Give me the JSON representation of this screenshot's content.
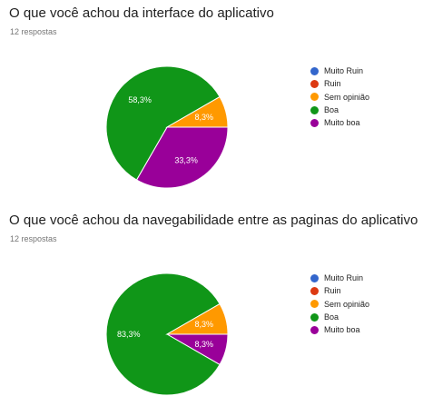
{
  "chart_data": [
    {
      "type": "pie",
      "title": "O que você achou da interface do aplicativo",
      "subtitle": "12 respostas",
      "legend_position": "right",
      "categories": [
        "Muito Ruin",
        "Ruin",
        "Sem opinião",
        "Boa",
        "Muito boa"
      ],
      "colors": [
        "#3366cc",
        "#dc3912",
        "#ff9900",
        "#109618",
        "#990099"
      ],
      "values": [
        0,
        0,
        8.3,
        58.3,
        33.3
      ],
      "labels": [
        "",
        "",
        "8,3%",
        "58,3%",
        "33,3%"
      ]
    },
    {
      "type": "pie",
      "title": "O que você achou da navegabilidade entre as paginas do aplicativo",
      "subtitle": "12 respostas",
      "legend_position": "right",
      "categories": [
        "Muito Ruin",
        "Ruin",
        "Sem opinião",
        "Boa",
        "Muito boa"
      ],
      "colors": [
        "#3366cc",
        "#dc3912",
        "#ff9900",
        "#109618",
        "#990099"
      ],
      "values": [
        0,
        0,
        8.3,
        83.3,
        8.3
      ],
      "labels": [
        "",
        "",
        "8,3%",
        "83,3%",
        "8,3%"
      ]
    }
  ]
}
